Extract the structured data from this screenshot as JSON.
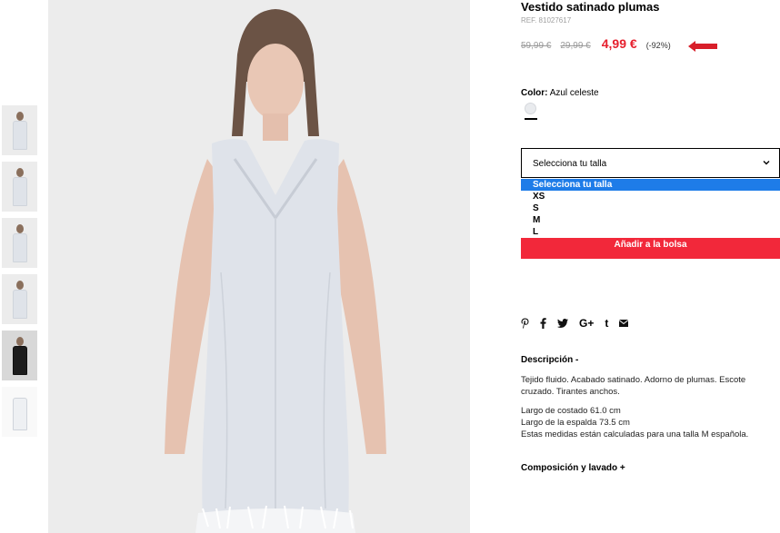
{
  "thumbnails": [
    {
      "label": "",
      "variant": "dress-front"
    },
    {
      "label": "",
      "variant": "dress-side"
    },
    {
      "label": "",
      "variant": "dress-back"
    },
    {
      "label": "",
      "variant": "dress-detail"
    },
    {
      "label": "",
      "variant": "dress-dark-jacket"
    },
    {
      "label": "",
      "variant": "dress-flat"
    }
  ],
  "product": {
    "title": "Vestido satinado plumas",
    "ref": "REF. 81027617",
    "old_price_1": "59,99 €",
    "old_price_2": "29,99 €",
    "current_price": "4,99 €",
    "discount": "(-92%)",
    "color_label": "Color:",
    "color_value": "Azul celeste",
    "size_select": {
      "selected": "Selecciona tu talla",
      "options": [
        "Selecciona tu talla",
        "XS",
        "S",
        "M",
        "L"
      ]
    },
    "add_to_bag": "Añadir a la bolsa",
    "share_icons": [
      "pinterest-icon",
      "facebook-icon",
      "twitter-icon",
      "google-plus-icon",
      "tumblr-icon",
      "email-icon"
    ],
    "description_title": "Descripción -",
    "description": "Tejido fluido. Acabado satinado. Adorno de plumas. Escote cruzado. Tirantes anchos.",
    "measures": [
      "Largo de costado 61.0 cm",
      "Largo de la espalda 73.5 cm",
      "Estas medidas están calculadas para una talla M española."
    ],
    "composition_title": "Composición y lavado +"
  },
  "colors": {
    "accent": "#f2283a",
    "price": "#e6202e",
    "selected_option": "#1e7ce8"
  }
}
